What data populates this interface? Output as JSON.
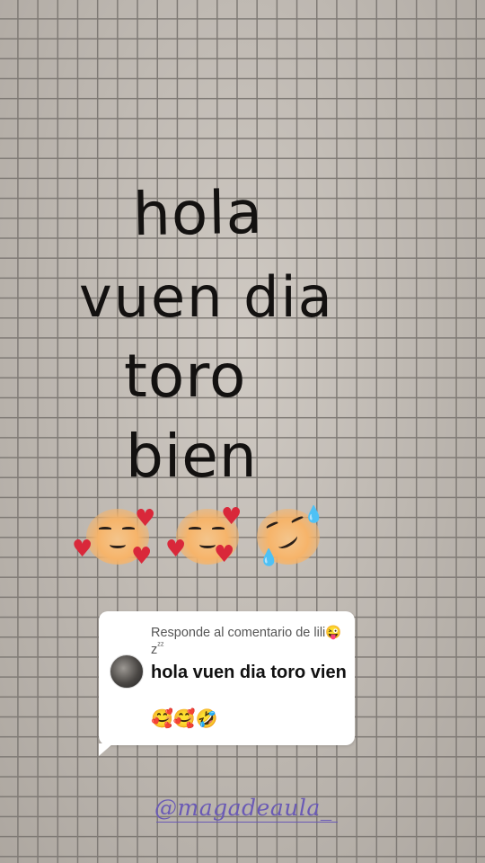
{
  "handwriting": {
    "line1": "hola",
    "line2": "vuen dia",
    "line3": "toro",
    "line4": "bien"
  },
  "drawn_emojis": [
    "smiling-face-with-hearts",
    "smiling-face-with-hearts",
    "rolling-on-floor-laughing"
  ],
  "comment": {
    "reply_prefix": "Responde al comentario de",
    "username": "lili",
    "username_emoji": "😜",
    "username_suffix": "z",
    "sleep_marks": "ᶻᶻ",
    "text": "hola vuen dia toro vien",
    "emojis": "🥰🥰🤣"
  },
  "watermark": "@magadeaula_",
  "colors": {
    "grid_line": "#7f7a75",
    "paper": "#c5beb6",
    "watermark": "#6a5ab5",
    "heart": "#d9283a"
  }
}
